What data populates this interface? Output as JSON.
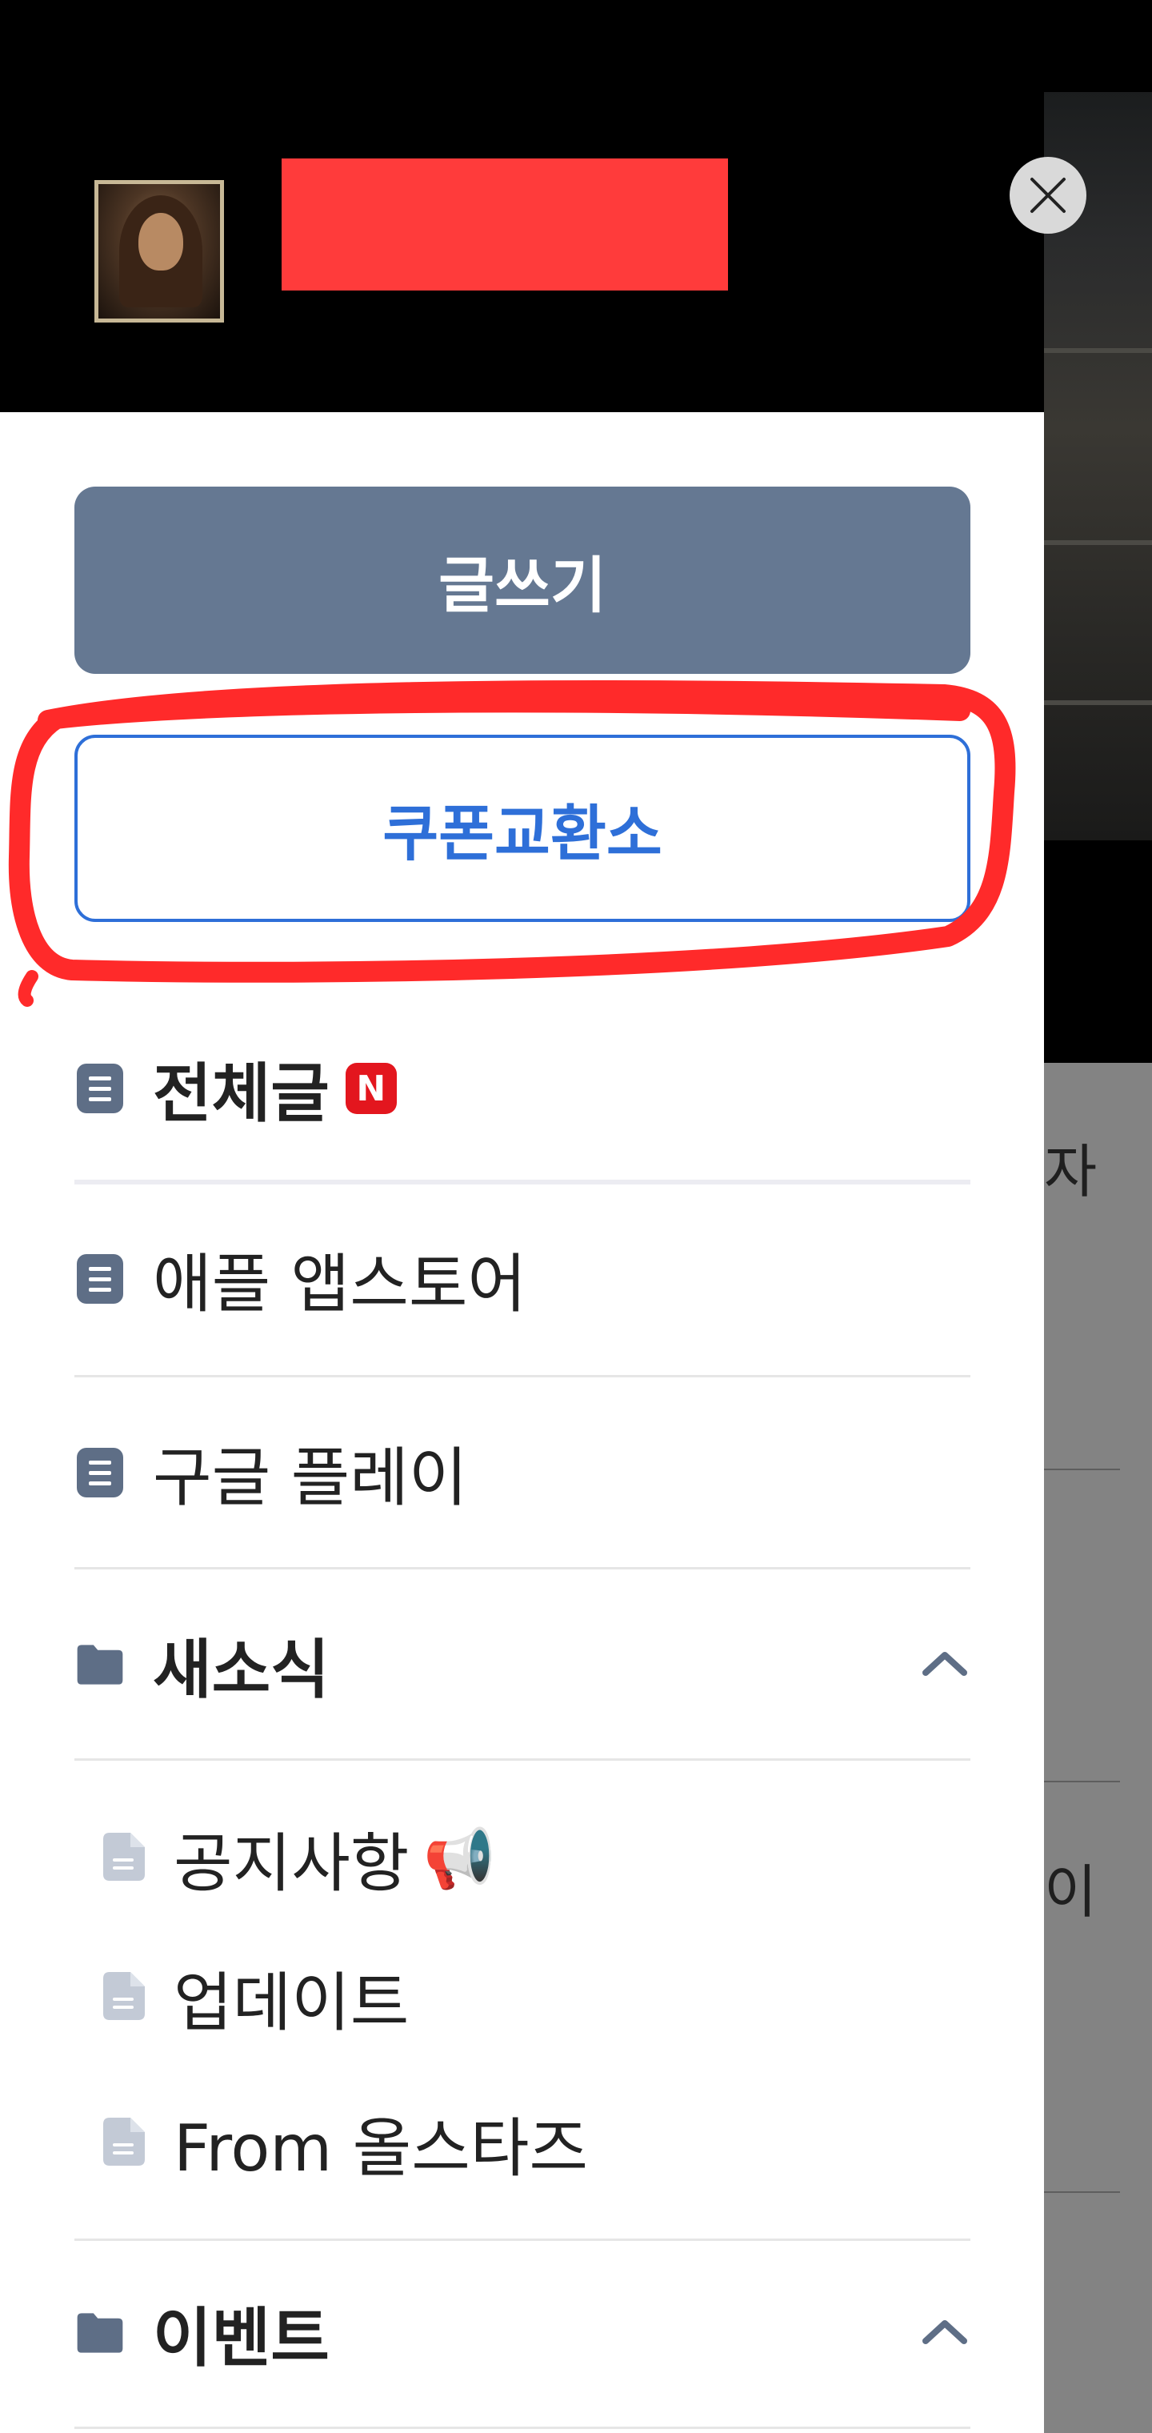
{
  "drawer": {
    "write_button": "글쓰기",
    "coupon_button": "쿠폰교환소",
    "menu": {
      "all_posts": {
        "label": "전체글",
        "badge": "N"
      },
      "apple": "애플 앱스토어",
      "google": "구글 플레이",
      "news": {
        "label": "새소식",
        "items": [
          "공지사항",
          "업데이트",
          "From 올스타즈"
        ],
        "notice_emoji": "📢"
      },
      "events": {
        "label": "이벤트"
      }
    }
  },
  "background": {
    "snippets": [
      "자",
      "이"
    ]
  },
  "colors": {
    "primary_button": "#657892",
    "coupon_accent": "#2e6fd8",
    "annotation": "#ff2a2a",
    "badge": "#e3161e"
  },
  "icons": [
    "close-icon",
    "document-icon",
    "folder-icon",
    "chevron-up-icon",
    "megaphone-icon"
  ]
}
